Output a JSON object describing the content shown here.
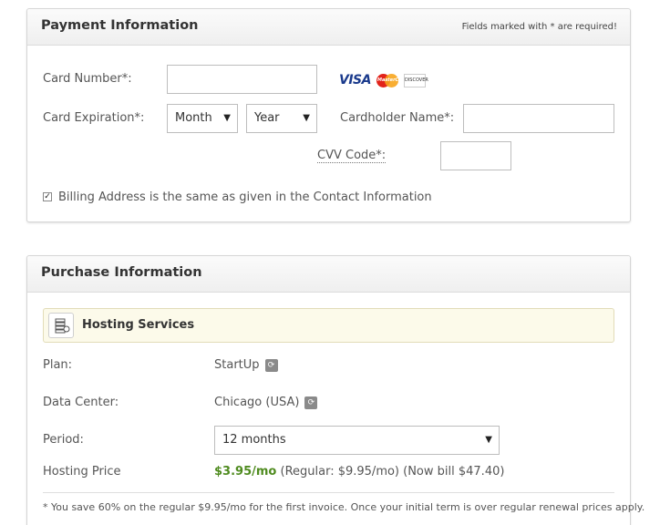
{
  "payment": {
    "title": "Payment Information",
    "required_note": "Fields marked with * are required!",
    "card_number_label": "Card Number*:",
    "card_expiration_label": "Card Expiration*:",
    "month_select": "Month",
    "year_select": "Year",
    "cardholder_label": "Cardholder Name*:",
    "cvv_label": "CVV Code*:",
    "billing_checkbox_label": "Billing Address is the same as given in the Contact Information",
    "billing_checked": true,
    "card_logos": [
      "VISA",
      "MasterCard",
      "DISCOVER"
    ]
  },
  "purchase": {
    "title": "Purchase Information",
    "service_title": "Hosting Services",
    "plan_label": "Plan:",
    "plan_value": "StartUp",
    "datacenter_label": "Data Center:",
    "datacenter_value": "Chicago (USA)",
    "period_label": "Period:",
    "period_value": "12 months",
    "price_label": "Hosting Price",
    "price_value": "$3.95/mo",
    "price_detail": "(Regular: $9.95/mo) (Now bill $47.40)",
    "footnote": "* You save 60% on the regular $9.95/mo for the first invoice. Once your initial term is over regular renewal prices apply."
  },
  "icons": {
    "select_arrow": "triangle-down",
    "refresh": "refresh-icon",
    "service": "server-stack-icon"
  },
  "colors": {
    "price_green": "#4f8b1f",
    "service_bar_bg": "#fcfaea",
    "visa_blue": "#1a3a8c"
  }
}
